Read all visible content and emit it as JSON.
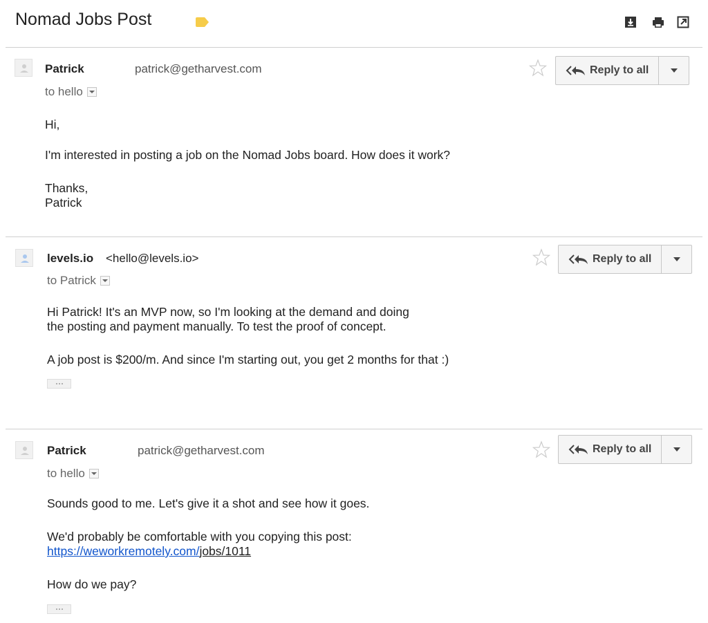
{
  "thread": {
    "subject": "Nomad Jobs Post",
    "label_color": "#f6cc4a"
  },
  "toolbar": {
    "icons": [
      "download-icon",
      "print-icon",
      "open-new-window-icon"
    ]
  },
  "messages": [
    {
      "sender_name": "Patrick",
      "sender_email": "patrick@getharvest.com",
      "to_label": "to hello",
      "reply_label": "Reply to all",
      "body": {
        "greeting": "Hi,",
        "line1": "I'm interested in posting a job on the Nomad Jobs board. How does it work?",
        "signoff1": "Thanks,",
        "signoff2": "Patrick"
      }
    },
    {
      "sender_name": "levels.io",
      "sender_email": "<hello@levels.io>",
      "to_label": "to Patrick",
      "reply_label": "Reply to all",
      "body": {
        "line1": "Hi Patrick! It's an MVP now, so I'm looking at the demand and doing",
        "line2": "the posting and payment manually. To test the proof of concept.",
        "line3": "A job post is $200/m. And since I'm starting out, you get 2 months for that :)"
      }
    },
    {
      "sender_name": "Patrick",
      "sender_email": "patrick@getharvest.com",
      "to_label": "to hello",
      "reply_label": "Reply to all",
      "body": {
        "line1": "Sounds good to me. Let's give it a shot and see how it goes.",
        "line2": "We'd probably be comfortable with you copying this post:",
        "link_part1": "https://weworkremotely.com/",
        "link_part2": "jobs/1011",
        "line3": "How do we pay?"
      }
    }
  ]
}
